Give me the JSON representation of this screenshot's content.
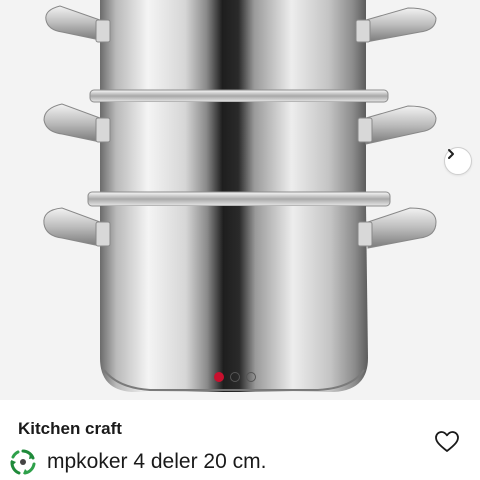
{
  "product": {
    "brand": "Kitchen craft",
    "title": "mpkoker 4 deler 20 cm."
  },
  "gallery": {
    "image_alt": "stainless-steel-steamer-pot-photo",
    "image_count": 3,
    "active_index": 0
  },
  "icons": {
    "next": "chevron-right-icon",
    "favorite": "heart-outline-icon",
    "reuse": "recycle-icon"
  },
  "colors": {
    "active_dot": "#c8102e",
    "text": "#1a1a1a"
  }
}
